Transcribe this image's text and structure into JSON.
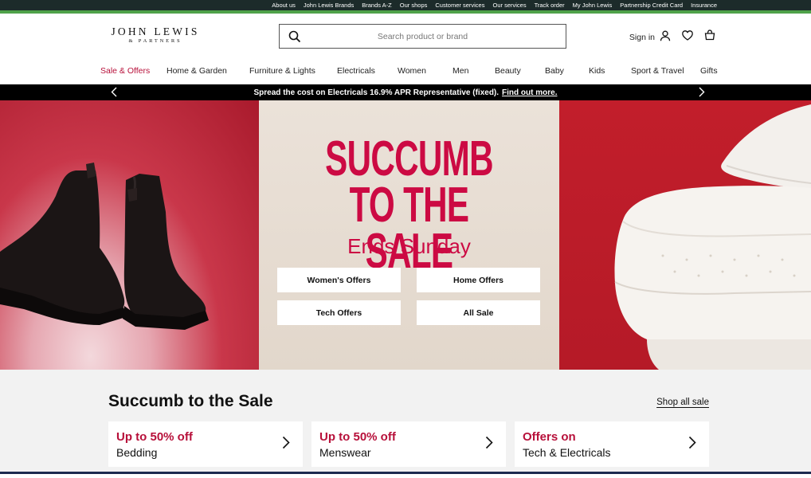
{
  "utility_links": [
    "About us",
    "John Lewis Brands",
    "Brands A-Z",
    "Our shops",
    "Customer services",
    "Our services",
    "Track order",
    "My John Lewis",
    "Partnership Credit Card",
    "Insurance"
  ],
  "logo": {
    "line1": "JOHN LEWIS",
    "line2": "& PARTNERS"
  },
  "search": {
    "placeholder": "Search product or brand"
  },
  "header": {
    "signin_label": "Sign in"
  },
  "nav": [
    {
      "label": "Sale & Offers"
    },
    {
      "label": "Home & Garden"
    },
    {
      "label": "Furniture & Lights"
    },
    {
      "label": "Electricals"
    },
    {
      "label": "Women"
    },
    {
      "label": "Men"
    },
    {
      "label": "Beauty"
    },
    {
      "label": "Baby"
    },
    {
      "label": "Kids"
    },
    {
      "label": "Sport & Travel"
    },
    {
      "label": "Gifts"
    }
  ],
  "promo": {
    "text": "Spread the cost on Electricals 16.9% APR Representative (fixed).",
    "link": "Find out more."
  },
  "hero": {
    "headline_line1": "SUCCUMB",
    "headline_line2": "TO THE SALE",
    "subhead": "Ends Sunday",
    "buttons": [
      "Women's Offers",
      "Home Offers",
      "Tech Offers",
      "All Sale"
    ]
  },
  "section": {
    "title": "Succumb to the Sale",
    "shop_all": "Shop all sale",
    "cards": [
      {
        "headline": "Up to 50% off",
        "category": "Bedding"
      },
      {
        "headline": "Up to 50% off",
        "category": "Menswear"
      },
      {
        "headline": "Offers on",
        "category": "Tech & Electricals"
      }
    ]
  },
  "colors": {
    "accent": "#b7103a",
    "headline": "#cc0a43",
    "utility_bar": "#1c2b2a",
    "green_strip": "#4fa24a"
  }
}
